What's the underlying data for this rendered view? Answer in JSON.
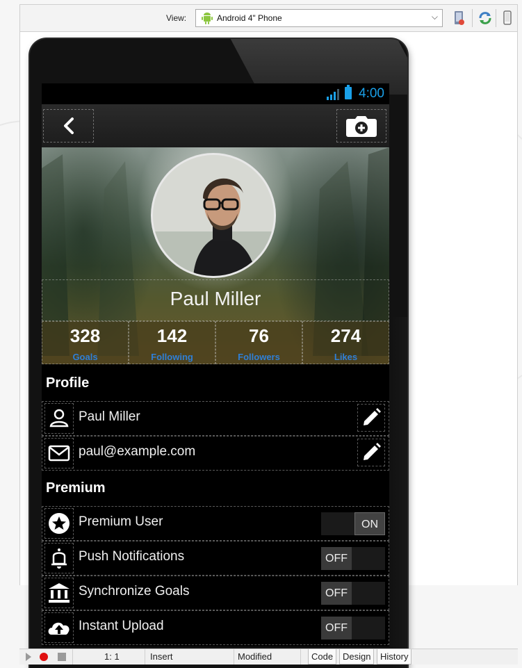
{
  "toolbar": {
    "view_label": "View:",
    "view_value": "Android 4\" Phone",
    "icons": [
      "android-icon",
      "chevron-down-icon",
      "device-icon",
      "refresh-icon",
      "phone-outline-icon"
    ]
  },
  "status_bar": {
    "time": "4:00",
    "accent": "#1aa0e8"
  },
  "profile_header": {
    "name": "Paul Miller",
    "stats": [
      {
        "value": "328",
        "label": "Goals"
      },
      {
        "value": "142",
        "label": "Following"
      },
      {
        "value": "76",
        "label": "Followers"
      },
      {
        "value": "274",
        "label": "Likes"
      }
    ],
    "stat_label_color": "#2f7fd6"
  },
  "profile": {
    "title": "Profile",
    "rows": [
      {
        "icon": "person-icon",
        "text": "Paul Miller"
      },
      {
        "icon": "mail-icon",
        "text": "paul@example.com"
      }
    ]
  },
  "premium": {
    "title": "Premium",
    "rows": [
      {
        "icon": "star-icon",
        "text": "Premium User",
        "toggle": "ON"
      },
      {
        "icon": "bell-icon",
        "text": "Push Notifications",
        "toggle": "OFF"
      },
      {
        "icon": "bank-icon",
        "text": "Synchronize Goals",
        "toggle": "OFF"
      },
      {
        "icon": "cloud-upload-icon",
        "text": "Instant Upload",
        "toggle": "OFF"
      }
    ]
  },
  "editor_status": {
    "position": "1:  1",
    "mode": "Insert",
    "state": "Modified",
    "tabs": [
      "Code",
      "Design",
      "History"
    ]
  }
}
